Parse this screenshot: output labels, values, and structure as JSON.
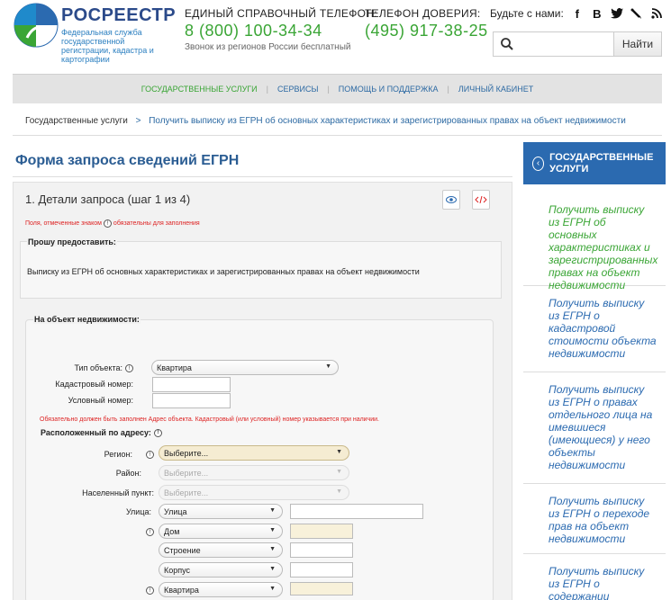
{
  "header": {
    "brand_name": "РОСРЕЕСТР",
    "brand_sub": "Федеральная служба государственной регистрации, кадастра и картографии",
    "helpline_label": "ЕДИНЫЙ СПРАВОЧНЫЙ ТЕЛЕФОН:",
    "helpline_number": "8 (800) 100-34-34",
    "helpline_note": "Звонок из регионов России бесплатный",
    "trust_label": "ТЕЛЕФОН ДОВЕРИЯ:",
    "trust_number": "(495) 917-38-25",
    "social_label": "Будьте с нами:",
    "search_placeholder": "",
    "search_button": "Найти"
  },
  "nav": {
    "items": [
      "ГОСУДАРСТВЕННЫЕ УСЛУГИ",
      "СЕРВИСЫ",
      "ПОМОЩЬ И ПОДДЕРЖКА",
      "ЛИЧНЫЙ КАБИНЕТ"
    ],
    "separator": "|"
  },
  "breadcrumb": {
    "root": "Государственные услуги",
    "arrow": ">",
    "current": "Получить выписку из ЕГРН об основных характеристиках и зарегистрированных правах на объект недвижимости"
  },
  "form": {
    "title": "Форма запроса сведений ЕГРН",
    "step": "1. Детали запроса (шаг 1 из 4)",
    "required_note_before": "Поля, отмеченные знаком",
    "required_note_after": "обязательны для заполнения",
    "request_label": "Прошу предоставить:",
    "request_text": "Выписку из ЕГРН об основных характеристиках и зарегистрированных правах на объект недвижимости",
    "property_label": "На объект недвижимости:",
    "object_type_label": "Тип объекта:",
    "object_type_value": "Квартира",
    "cadastral_label": "Кадастровый номер:",
    "conditional_label": "Условный номер:",
    "address_note": "Обязательно должен быть заполнен Адрес объекта. Кадастровый (или условный) номер указывается при наличии.",
    "address_heading": "Расположенный по адресу:",
    "region_label": "Регион:",
    "region_value": "Выберите...",
    "district_label": "Район:",
    "district_value": "Выберите...",
    "locality_label": "Населенный пункт:",
    "locality_value": "Выберите...",
    "street_label": "Улица:",
    "street_type": "Улица",
    "house_type": "Дом",
    "building_type": "Строение",
    "corpus_type": "Корпус",
    "apartment_type": "Квартира",
    "info_glyph": "!"
  },
  "sidebar": {
    "heading": "ГОСУДАРСТВЕННЫЕ УСЛУГИ",
    "items": [
      "Получить выписку из ЕГРН об основных характеристиках и зарегистрированных правах на объект недвижимости",
      "Получить выписку из ЕГРН о кадастровой стоимости объекта недвижимости",
      "Получить выписку из ЕГРН о правах отдельного лица на имевшиеся (имеющиеся) у него объекты недвижимости",
      "Получить выписку из ЕГРН о переходе прав на объект недвижимости",
      "Получить выписку из ЕГРН о содержании"
    ]
  },
  "colors": {
    "brand_blue": "#2b6ab0",
    "accent_green": "#3aa535",
    "required_red": "#dd2222"
  }
}
